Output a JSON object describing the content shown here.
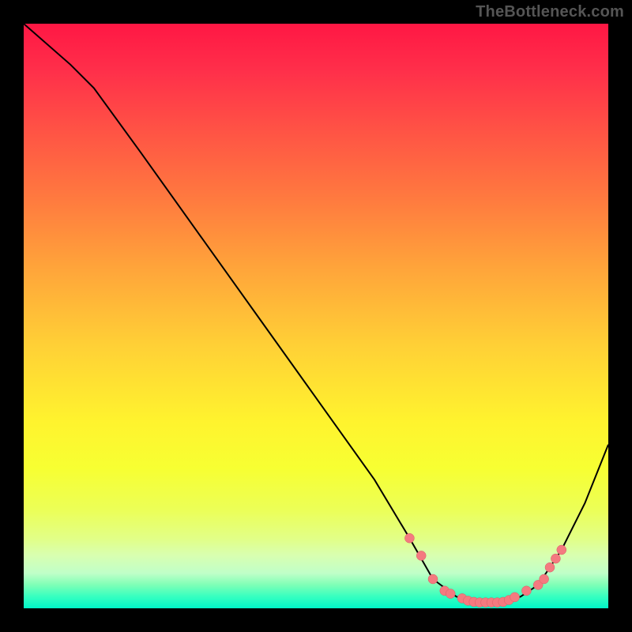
{
  "watermark": "TheBottleneck.com",
  "colors": {
    "background": "#000000",
    "dot_fill": "#f47a80",
    "dot_stroke": "#d85c62",
    "curve_stroke": "#000000"
  },
  "chart_data": {
    "type": "line",
    "title": "",
    "xlabel": "",
    "ylabel": "",
    "xlim": [
      0,
      100
    ],
    "ylim": [
      0,
      100
    ],
    "series": [
      {
        "name": "curve",
        "x": [
          0,
          8,
          12,
          20,
          30,
          40,
          50,
          60,
          66,
          70,
          74,
          78,
          82,
          85,
          88,
          92,
          96,
          100
        ],
        "y": [
          100,
          93,
          89,
          78,
          64,
          50,
          36,
          22,
          12,
          5,
          2,
          1,
          1,
          2,
          4,
          10,
          18,
          28
        ]
      }
    ],
    "highlight_points": {
      "name": "cluster",
      "x": [
        66,
        68,
        70,
        72,
        73,
        75,
        76,
        77,
        78,
        79,
        80,
        81,
        82,
        83,
        84,
        86,
        88,
        89,
        90,
        91,
        92
      ],
      "y": [
        12,
        9,
        5,
        3,
        2.5,
        1.7,
        1.3,
        1.1,
        1,
        1,
        1,
        1,
        1.1,
        1.4,
        1.9,
        3,
        4,
        5,
        7,
        8.5,
        10
      ]
    }
  }
}
